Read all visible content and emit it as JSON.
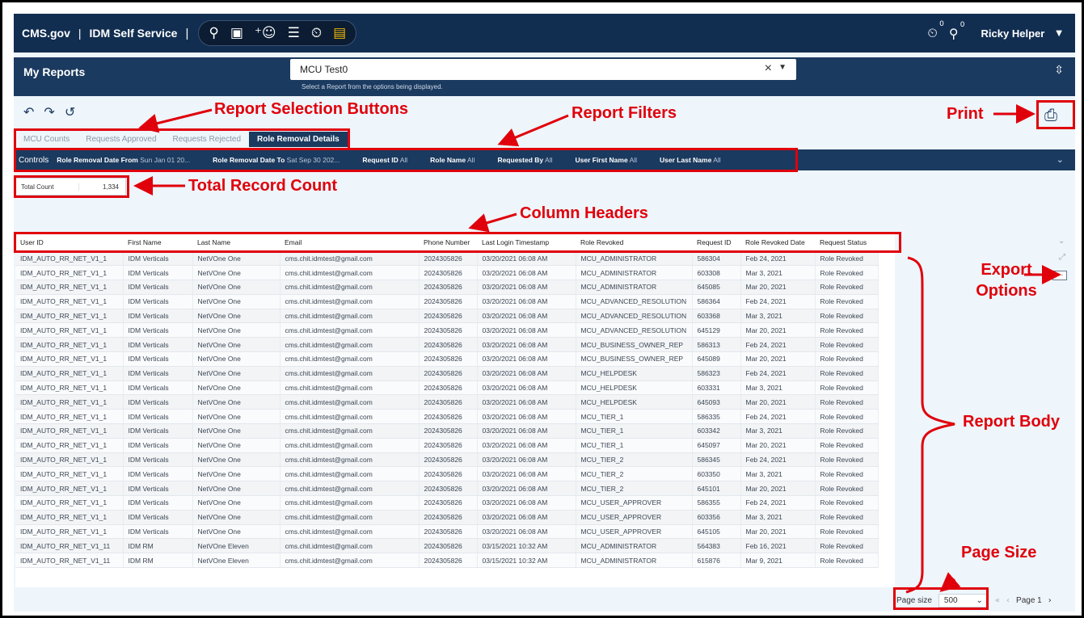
{
  "header": {
    "brand": "CMS.gov",
    "separator": "|",
    "app_name": "IDM Self Service",
    "pill_icons": [
      "person-lock-icon",
      "id-card-icon",
      "add-user-icon",
      "user-list-icon",
      "user-clock-icon",
      "report-doc-icon"
    ],
    "notification_icons": [
      {
        "name": "user-clock-icon",
        "badge": "0"
      },
      {
        "name": "person-lock-icon",
        "badge": "0"
      }
    ],
    "user_name": "Ricky Helper"
  },
  "report_bar": {
    "title": "My Reports",
    "selected_report": "MCU Test0",
    "hint": "Select a Report from the options being displayed."
  },
  "tabs": [
    {
      "label": "MCU Counts",
      "active": false
    },
    {
      "label": "Requests Approved",
      "active": false
    },
    {
      "label": "Requests Rejected",
      "active": false
    },
    {
      "label": "Role Removal Details",
      "active": true
    }
  ],
  "controls": {
    "label": "Controls",
    "filters": [
      {
        "name": "Role Removal Date From",
        "value": "Sun Jan 01 20..."
      },
      {
        "name": "Role Removal Date To",
        "value": "Sat Sep 30 202..."
      },
      {
        "name": "Request ID",
        "value": "All"
      },
      {
        "name": "Role Name",
        "value": "All"
      },
      {
        "name": "Requested By",
        "value": "All"
      },
      {
        "name": "User First Name",
        "value": "All"
      },
      {
        "name": "User Last Name",
        "value": "All"
      }
    ]
  },
  "total": {
    "label": "Total Count",
    "value": "1,334"
  },
  "table": {
    "columns": [
      "User ID",
      "First Name",
      "Last Name",
      "Email",
      "Phone Number",
      "Last Login Timestamp",
      "Role Revoked",
      "Request ID",
      "Role Revoked Date",
      "Request Status"
    ],
    "rows": [
      [
        "IDM_AUTO_RR_NET_V1_1",
        "IDM Verticals",
        "NetVOne One",
        "cms.chit.idmtest@gmail.com",
        "2024305826",
        "03/20/2021 06:08 AM",
        "MCU_ADMINISTRATOR",
        "586304",
        "Feb 24, 2021",
        "Role Revoked"
      ],
      [
        "IDM_AUTO_RR_NET_V1_1",
        "IDM Verticals",
        "NetVOne One",
        "cms.chit.idmtest@gmail.com",
        "2024305826",
        "03/20/2021 06:08 AM",
        "MCU_ADMINISTRATOR",
        "603308",
        "Mar 3, 2021",
        "Role Revoked"
      ],
      [
        "IDM_AUTO_RR_NET_V1_1",
        "IDM Verticals",
        "NetVOne One",
        "cms.chit.idmtest@gmail.com",
        "2024305826",
        "03/20/2021 06:08 AM",
        "MCU_ADMINISTRATOR",
        "645085",
        "Mar 20, 2021",
        "Role Revoked"
      ],
      [
        "IDM_AUTO_RR_NET_V1_1",
        "IDM Verticals",
        "NetVOne One",
        "cms.chit.idmtest@gmail.com",
        "2024305826",
        "03/20/2021 06:08 AM",
        "MCU_ADVANCED_RESOLUTION",
        "586364",
        "Feb 24, 2021",
        "Role Revoked"
      ],
      [
        "IDM_AUTO_RR_NET_V1_1",
        "IDM Verticals",
        "NetVOne One",
        "cms.chit.idmtest@gmail.com",
        "2024305826",
        "03/20/2021 06:08 AM",
        "MCU_ADVANCED_RESOLUTION",
        "603368",
        "Mar 3, 2021",
        "Role Revoked"
      ],
      [
        "IDM_AUTO_RR_NET_V1_1",
        "IDM Verticals",
        "NetVOne One",
        "cms.chit.idmtest@gmail.com",
        "2024305826",
        "03/20/2021 06:08 AM",
        "MCU_ADVANCED_RESOLUTION",
        "645129",
        "Mar 20, 2021",
        "Role Revoked"
      ],
      [
        "IDM_AUTO_RR_NET_V1_1",
        "IDM Verticals",
        "NetVOne One",
        "cms.chit.idmtest@gmail.com",
        "2024305826",
        "03/20/2021 06:08 AM",
        "MCU_BUSINESS_OWNER_REP",
        "586313",
        "Feb 24, 2021",
        "Role Revoked"
      ],
      [
        "IDM_AUTO_RR_NET_V1_1",
        "IDM Verticals",
        "NetVOne One",
        "cms.chit.idmtest@gmail.com",
        "2024305826",
        "03/20/2021 06:08 AM",
        "MCU_BUSINESS_OWNER_REP",
        "645089",
        "Mar 20, 2021",
        "Role Revoked"
      ],
      [
        "IDM_AUTO_RR_NET_V1_1",
        "IDM Verticals",
        "NetVOne One",
        "cms.chit.idmtest@gmail.com",
        "2024305826",
        "03/20/2021 06:08 AM",
        "MCU_HELPDESK",
        "586323",
        "Feb 24, 2021",
        "Role Revoked"
      ],
      [
        "IDM_AUTO_RR_NET_V1_1",
        "IDM Verticals",
        "NetVOne One",
        "cms.chit.idmtest@gmail.com",
        "2024305826",
        "03/20/2021 06:08 AM",
        "MCU_HELPDESK",
        "603331",
        "Mar 3, 2021",
        "Role Revoked"
      ],
      [
        "IDM_AUTO_RR_NET_V1_1",
        "IDM Verticals",
        "NetVOne One",
        "cms.chit.idmtest@gmail.com",
        "2024305826",
        "03/20/2021 06:08 AM",
        "MCU_HELPDESK",
        "645093",
        "Mar 20, 2021",
        "Role Revoked"
      ],
      [
        "IDM_AUTO_RR_NET_V1_1",
        "IDM Verticals",
        "NetVOne One",
        "cms.chit.idmtest@gmail.com",
        "2024305826",
        "03/20/2021 06:08 AM",
        "MCU_TIER_1",
        "586335",
        "Feb 24, 2021",
        "Role Revoked"
      ],
      [
        "IDM_AUTO_RR_NET_V1_1",
        "IDM Verticals",
        "NetVOne One",
        "cms.chit.idmtest@gmail.com",
        "2024305826",
        "03/20/2021 06:08 AM",
        "MCU_TIER_1",
        "603342",
        "Mar 3, 2021",
        "Role Revoked"
      ],
      [
        "IDM_AUTO_RR_NET_V1_1",
        "IDM Verticals",
        "NetVOne One",
        "cms.chit.idmtest@gmail.com",
        "2024305826",
        "03/20/2021 06:08 AM",
        "MCU_TIER_1",
        "645097",
        "Mar 20, 2021",
        "Role Revoked"
      ],
      [
        "IDM_AUTO_RR_NET_V1_1",
        "IDM Verticals",
        "NetVOne One",
        "cms.chit.idmtest@gmail.com",
        "2024305826",
        "03/20/2021 06:08 AM",
        "MCU_TIER_2",
        "586345",
        "Feb 24, 2021",
        "Role Revoked"
      ],
      [
        "IDM_AUTO_RR_NET_V1_1",
        "IDM Verticals",
        "NetVOne One",
        "cms.chit.idmtest@gmail.com",
        "2024305826",
        "03/20/2021 06:08 AM",
        "MCU_TIER_2",
        "603350",
        "Mar 3, 2021",
        "Role Revoked"
      ],
      [
        "IDM_AUTO_RR_NET_V1_1",
        "IDM Verticals",
        "NetVOne One",
        "cms.chit.idmtest@gmail.com",
        "2024305826",
        "03/20/2021 06:08 AM",
        "MCU_TIER_2",
        "645101",
        "Mar 20, 2021",
        "Role Revoked"
      ],
      [
        "IDM_AUTO_RR_NET_V1_1",
        "IDM Verticals",
        "NetVOne One",
        "cms.chit.idmtest@gmail.com",
        "2024305826",
        "03/20/2021 06:08 AM",
        "MCU_USER_APPROVER",
        "586355",
        "Feb 24, 2021",
        "Role Revoked"
      ],
      [
        "IDM_AUTO_RR_NET_V1_1",
        "IDM Verticals",
        "NetVOne One",
        "cms.chit.idmtest@gmail.com",
        "2024305826",
        "03/20/2021 06:08 AM",
        "MCU_USER_APPROVER",
        "603356",
        "Mar 3, 2021",
        "Role Revoked"
      ],
      [
        "IDM_AUTO_RR_NET_V1_1",
        "IDM Verticals",
        "NetVOne One",
        "cms.chit.idmtest@gmail.com",
        "2024305826",
        "03/20/2021 06:08 AM",
        "MCU_USER_APPROVER",
        "645105",
        "Mar 20, 2021",
        "Role Revoked"
      ],
      [
        "IDM_AUTO_RR_NET_V1_11",
        "IDM RM",
        "NetVOne Eleven",
        "cms.chit.idmtest@gmail.com",
        "2024305826",
        "03/15/2021 10:32 AM",
        "MCU_ADMINISTRATOR",
        "564383",
        "Feb 16, 2021",
        "Role Revoked"
      ],
      [
        "IDM_AUTO_RR_NET_V1_11",
        "IDM RM",
        "NetVOne Eleven",
        "cms.chit.idmtest@gmail.com",
        "2024305826",
        "03/15/2021 10:32 AM",
        "MCU_ADMINISTRATOR",
        "615876",
        "Mar 9, 2021",
        "Role Revoked"
      ]
    ]
  },
  "pager": {
    "label": "Page size",
    "size": "500",
    "page": "Page 1"
  },
  "annotations": {
    "report_selection": "Report Selection Buttons",
    "report_filters": "Report Filters",
    "print": "Print",
    "total_record_count": "Total Record Count",
    "column_headers": "Column Headers",
    "export_options": "Export Options",
    "report_body": "Report Body",
    "page_size": "Page Size",
    "annotation_color": "#e0000b"
  },
  "colors": {
    "nav_dark": "#112e51",
    "bar": "#1b3a5f",
    "background": "#eef5fb"
  }
}
